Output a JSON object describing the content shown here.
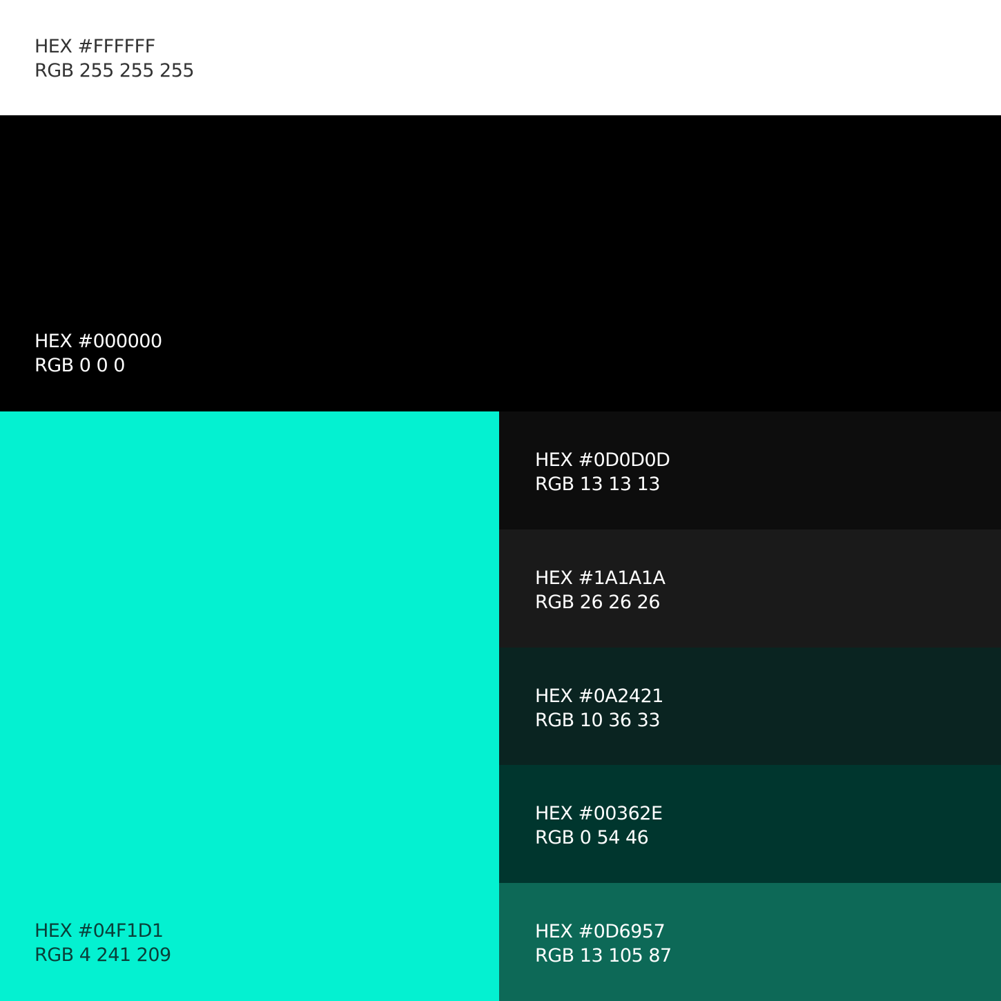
{
  "swatches": [
    {
      "id": "white",
      "hex_label": "HEX #FFFFFF",
      "rgb_label": "RGB 255 255 255",
      "color": "#FFFFFF",
      "text_color": "#333333"
    },
    {
      "id": "black",
      "hex_label": "HEX #000000",
      "rgb_label": "RGB 0 0 0",
      "color": "#000000",
      "text_color": "#FFFFFF"
    },
    {
      "id": "cyan",
      "hex_label": "HEX #04F1D1",
      "rgb_label": "RGB 4 241 209",
      "color": "#04F1D1",
      "text_color": "#0A3F39"
    },
    {
      "id": "0d0d0d",
      "hex_label": "HEX #0D0D0D",
      "rgb_label": "RGB 13 13 13",
      "color": "#0D0D0D",
      "text_color": "#FFFFFF"
    },
    {
      "id": "1a1a1a",
      "hex_label": "HEX #1A1A1A",
      "rgb_label": "RGB 26 26 26",
      "color": "#1A1A1A",
      "text_color": "#FFFFFF"
    },
    {
      "id": "0a2421",
      "hex_label": "HEX #0A2421",
      "rgb_label": "RGB 10 36 33",
      "color": "#0A2421",
      "text_color": "#FFFFFF"
    },
    {
      "id": "00362e",
      "hex_label": "HEX #00362E",
      "rgb_label": "RGB 0 54 46",
      "color": "#00362E",
      "text_color": "#FFFFFF"
    },
    {
      "id": "0d6957",
      "hex_label": "HEX #0D6957",
      "rgb_label": "RGB 13 105 87",
      "color": "#0D6957",
      "text_color": "#FFFFFF"
    }
  ]
}
